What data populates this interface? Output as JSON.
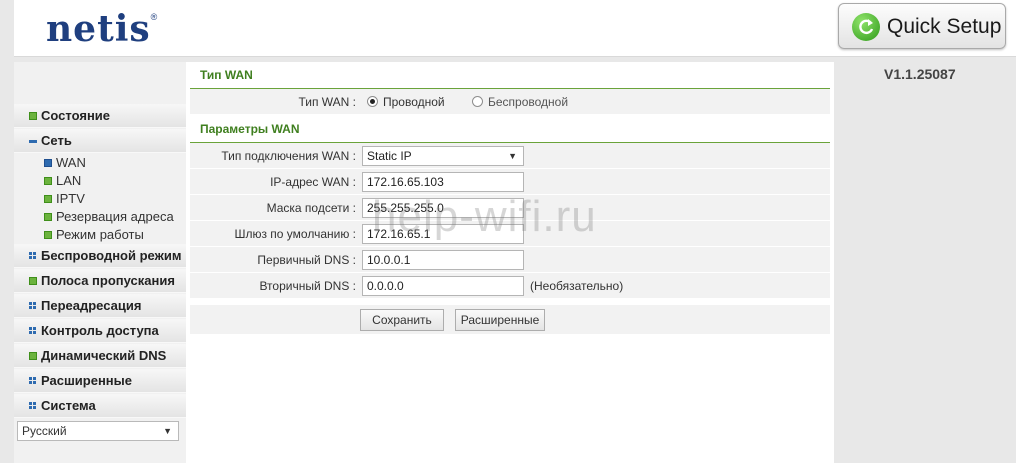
{
  "brand": {
    "logo_text": "netis",
    "logo_mark": "®"
  },
  "header": {
    "quick_setup_label": "Quick Setup"
  },
  "version": "V1.1.25087",
  "sidebar": {
    "items": [
      {
        "label": "Состояние"
      },
      {
        "label": "Сеть"
      },
      {
        "label": "Беспроводной режим"
      },
      {
        "label": "Полоса пропускания"
      },
      {
        "label": "Переадресация"
      },
      {
        "label": "Контроль доступа"
      },
      {
        "label": "Динамический DNS"
      },
      {
        "label": "Расширенные"
      },
      {
        "label": "Система"
      }
    ],
    "network_subitems": [
      {
        "label": "WAN",
        "active": true
      },
      {
        "label": "LAN"
      },
      {
        "label": "IPTV"
      },
      {
        "label": "Резервация адреса"
      },
      {
        "label": "Режим работы"
      }
    ],
    "language": "Русский"
  },
  "main": {
    "wan_type_section_title": "Тип WAN",
    "wan_type": {
      "label": "Тип WAN :",
      "options": [
        {
          "label": "Проводной",
          "selected": true
        },
        {
          "label": "Беспроводной",
          "selected": false
        }
      ]
    },
    "wan_params_section_title": "Параметры WAN",
    "connection_type": {
      "label": "Тип подключения WAN :",
      "value": "Static IP"
    },
    "wan_ip": {
      "label": "IP-адрес WAN :",
      "value": "172.16.65.103"
    },
    "subnet_mask": {
      "label": "Маска подсети :",
      "value": "255.255.255.0"
    },
    "gateway": {
      "label": "Шлюз по умолчанию :",
      "value": "172.16.65.1"
    },
    "primary_dns": {
      "label": "Первичный DNS :",
      "value": "10.0.0.1"
    },
    "secondary_dns": {
      "label": "Вторичный DNS :",
      "value": "0.0.0.0",
      "hint": "(Необязательно)"
    },
    "buttons": {
      "save": "Сохранить",
      "advanced": "Расширенные"
    }
  },
  "watermark": "help-wifi.ru",
  "colors": {
    "logo": "#1f3f7f",
    "section_title": "#3f7f1f",
    "accent_green": "#6cb33e",
    "icon_blue": "#2e6bb0"
  }
}
